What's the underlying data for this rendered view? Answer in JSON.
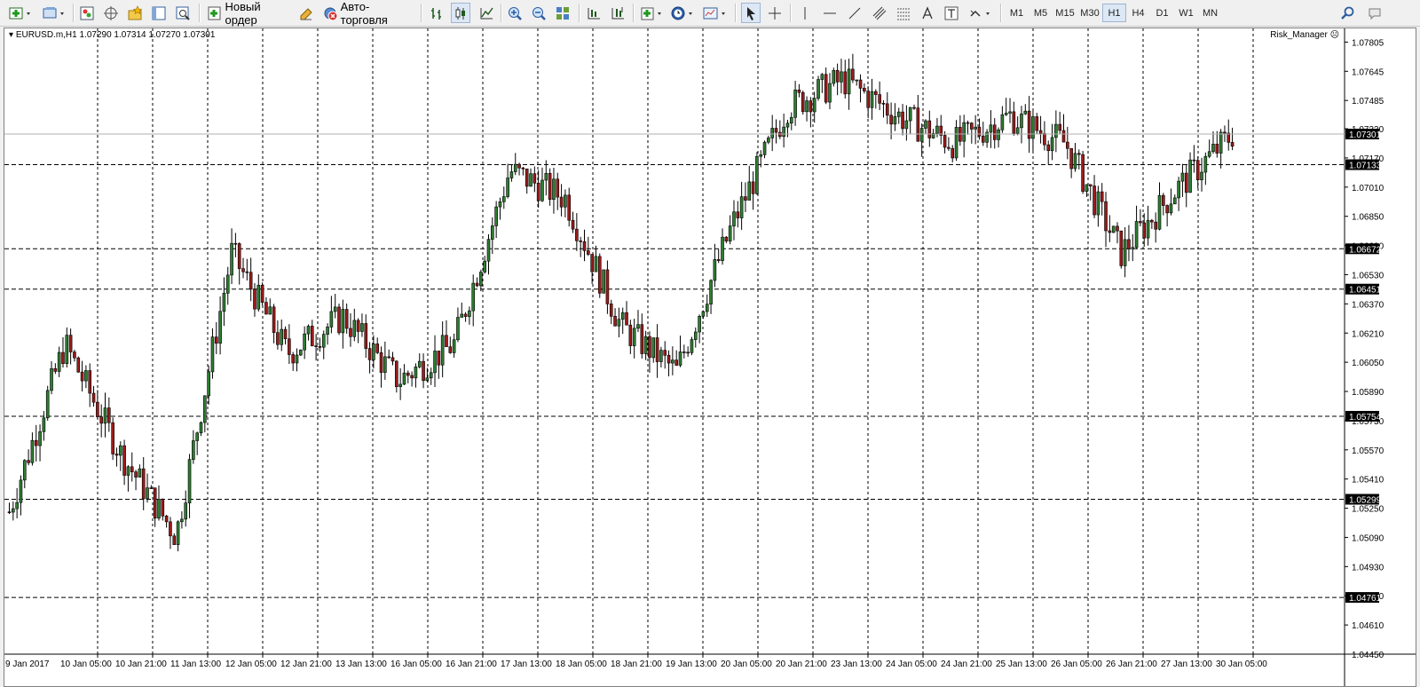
{
  "toolbar": {
    "new_order_label": "Новый ордер",
    "autotrading_label": "Авто-торговля",
    "timeframes": [
      "M1",
      "M5",
      "M15",
      "M30",
      "H1",
      "H4",
      "D1",
      "W1",
      "MN"
    ],
    "active_timeframe": "H1"
  },
  "chart": {
    "symbol_info": "EURUSD.m,H1  1.07290 1.07314 1.07270 1.07301",
    "expert_label": "Risk_Manager",
    "expert_icon": "smiley-frown-icon",
    "current_price": "1.07301",
    "colors": {
      "bull": "#2e7d32",
      "bear": "#9b1b1b",
      "background": "#ffffff",
      "grid": "#000000",
      "price_label_bg": "#000000",
      "price_label_fg": "#ffffff"
    },
    "price_axis": [
      "1.07805",
      "1.07645",
      "1.07485",
      "1.07330",
      "1.07170",
      "1.07010",
      "1.06850",
      "1.06690",
      "1.06530",
      "1.06370",
      "1.06210",
      "1.06050",
      "1.05890",
      "1.05730",
      "1.05570",
      "1.05410",
      "1.05250",
      "1.05090",
      "1.04930",
      "1.04770",
      "1.04610",
      "1.04450"
    ],
    "horizontal_levels": [
      "1.07133",
      "1.06672",
      "1.06451",
      "1.05754",
      "1.05299",
      "1.04761"
    ],
    "time_axis": [
      "9 Jan 2017",
      "10 Jan 05:00",
      "10 Jan 21:00",
      "11 Jan 13:00",
      "12 Jan 05:00",
      "12 Jan 21:00",
      "13 Jan 13:00",
      "16 Jan 05:00",
      "16 Jan 21:00",
      "17 Jan 13:00",
      "18 Jan 05:00",
      "18 Jan 21:00",
      "19 Jan 13:00",
      "20 Jan 05:00",
      "20 Jan 21:00",
      "23 Jan 13:00",
      "24 Jan 05:00",
      "24 Jan 21:00",
      "25 Jan 13:00",
      "26 Jan 05:00",
      "26 Jan 21:00",
      "27 Jan 13:00",
      "30 Jan 05:00"
    ]
  },
  "chart_data": {
    "type": "line",
    "title": "EURUSD.m,H1",
    "x": [
      "9 Jan 2017",
      "10 Jan 05:00",
      "10 Jan 21:00",
      "11 Jan 13:00",
      "12 Jan 05:00",
      "12 Jan 21:00",
      "13 Jan 13:00",
      "16 Jan 05:00",
      "16 Jan 21:00",
      "17 Jan 13:00",
      "18 Jan 05:00",
      "18 Jan 21:00",
      "19 Jan 13:00",
      "20 Jan 05:00",
      "20 Jan 21:00",
      "23 Jan 13:00",
      "24 Jan 05:00",
      "24 Jan 21:00",
      "25 Jan 13:00",
      "26 Jan 05:00",
      "26 Jan 21:00",
      "27 Jan 13:00",
      "30 Jan 05:00"
    ],
    "series": [
      {
        "values": [
          1.0523,
          1.0615,
          1.0555,
          1.051,
          1.0665,
          1.061,
          1.063,
          1.0595,
          1.0615,
          1.071,
          1.0695,
          1.0625,
          1.06,
          1.068,
          1.0745,
          1.076,
          1.074,
          1.0725,
          1.074,
          1.0725,
          1.0665,
          1.07,
          1.073
        ]
      }
    ],
    "ylim": [
      1.0445,
      1.0788
    ]
  }
}
